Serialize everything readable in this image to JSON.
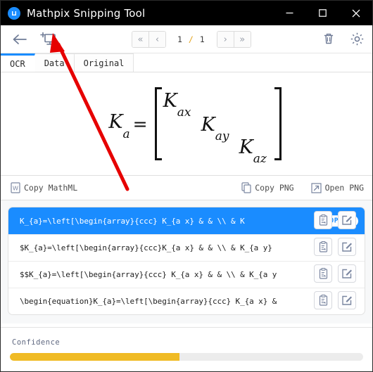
{
  "window": {
    "title": "Mathpix Snipping Tool",
    "logo_icon": "mathpix-logo-icon",
    "controls": {
      "minimize": "minimize-icon",
      "maximize": "maximize-icon",
      "close": "close-icon"
    }
  },
  "toolbar": {
    "back_icon": "back-arrow-icon",
    "new_snip_icon": "new-snip-monitor-icon",
    "pager": {
      "first_label": "«",
      "prev_label": "‹",
      "current": "1",
      "separator": "/",
      "total": "1",
      "next_label": "›",
      "last_label": "»"
    },
    "delete_icon": "trash-icon",
    "settings_icon": "gear-icon"
  },
  "tabs": [
    {
      "label": "OCR",
      "active": true
    },
    {
      "label": "Data",
      "active": false
    },
    {
      "label": "Original",
      "active": false
    }
  ],
  "preview": {
    "lhs": "K",
    "lhs_sub": "a",
    "equals": "=",
    "cells": [
      {
        "base": "K",
        "sub": "ax"
      },
      {
        "base": "K",
        "sub": "ay"
      },
      {
        "base": "K",
        "sub": "az"
      }
    ]
  },
  "copybar": {
    "copy_mathml": {
      "label": "Copy MathML",
      "icon": "word-doc-icon"
    },
    "copy_png": {
      "label": "Copy PNG",
      "icon": "copy-icon"
    },
    "open_png": {
      "label": "Open PNG",
      "icon": "external-link-icon"
    }
  },
  "results": {
    "copied_badge": "COPIED",
    "copy_icon": "clipboard-copy-icon",
    "edit_icon": "edit-square-icon",
    "rows": [
      {
        "text": "K_{a}=\\left[\\begin{array}{ccc} K_{a x} & & \\\\ & K",
        "selected": true,
        "copied": true
      },
      {
        "text": "$K_{a}=\\left[\\begin{array}{ccc}K_{a x} & & \\\\ & K_{a y}",
        "selected": false,
        "copied": false
      },
      {
        "text": "$$K_{a}=\\left[\\begin{array}{ccc} K_{a x} & & \\\\ & K_{a y",
        "selected": false,
        "copied": false
      },
      {
        "text": "\\begin{equation}K_{a}=\\left[\\begin{array}{ccc} K_{a x} &",
        "selected": false,
        "copied": false
      }
    ]
  },
  "confidence": {
    "label": "Confidence",
    "percent": 48,
    "fill_color": "#f0bb25",
    "track_color": "#ececec"
  },
  "annotation": {
    "arrow_color": "#e60000",
    "arrow_name": "red-pointer-arrow"
  },
  "colors": {
    "accent": "#1a8cff",
    "titlebar": "#000000",
    "icon": "#7a86a0"
  }
}
